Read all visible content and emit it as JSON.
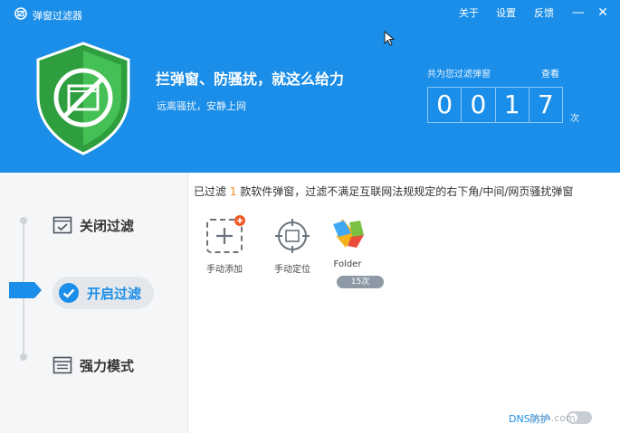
{
  "app": {
    "title": "弹窗过滤器",
    "logo_icon": "logo-icon"
  },
  "menu": {
    "about": "关于",
    "settings": "设置",
    "feedback": "反馈"
  },
  "window": {
    "minimize": "—",
    "close": "✕"
  },
  "hero": {
    "slogan": "拦弹窗、防骚扰，就这么给力",
    "subslogan": "远离骚扰，安静上网",
    "counter_label": "共为您过滤弹窗",
    "counter_view": "查看",
    "digits": [
      "0",
      "0",
      "1",
      "7"
    ],
    "counter_unit": "次"
  },
  "sidebar": {
    "items": [
      {
        "label": "关闭过滤",
        "icon": "window-check-icon"
      },
      {
        "label": "开启过滤",
        "icon": "checkmark-circle-icon",
        "active": true
      },
      {
        "label": "强力模式",
        "icon": "window-panel-icon"
      }
    ]
  },
  "main": {
    "desc_prefix": "已过滤 ",
    "desc_count": "1",
    "desc_suffix": " 款软件弹窗，过滤不满足互联网法规规定的右下角/中间/网页骚扰弹窗",
    "tools": [
      {
        "label": "手动添加",
        "icon": "add-dashed-icon"
      },
      {
        "label": "手动定位",
        "icon": "crosshair-icon"
      },
      {
        "label": "Folder",
        "icon": "folder-app-icon",
        "badge": "15次"
      }
    ],
    "dns_label": "DNS防护",
    "watermark": "pcm.com"
  },
  "colors": {
    "primary": "#1a8ee8",
    "shield": "#3bb54a",
    "accent": "#f28a1b"
  }
}
